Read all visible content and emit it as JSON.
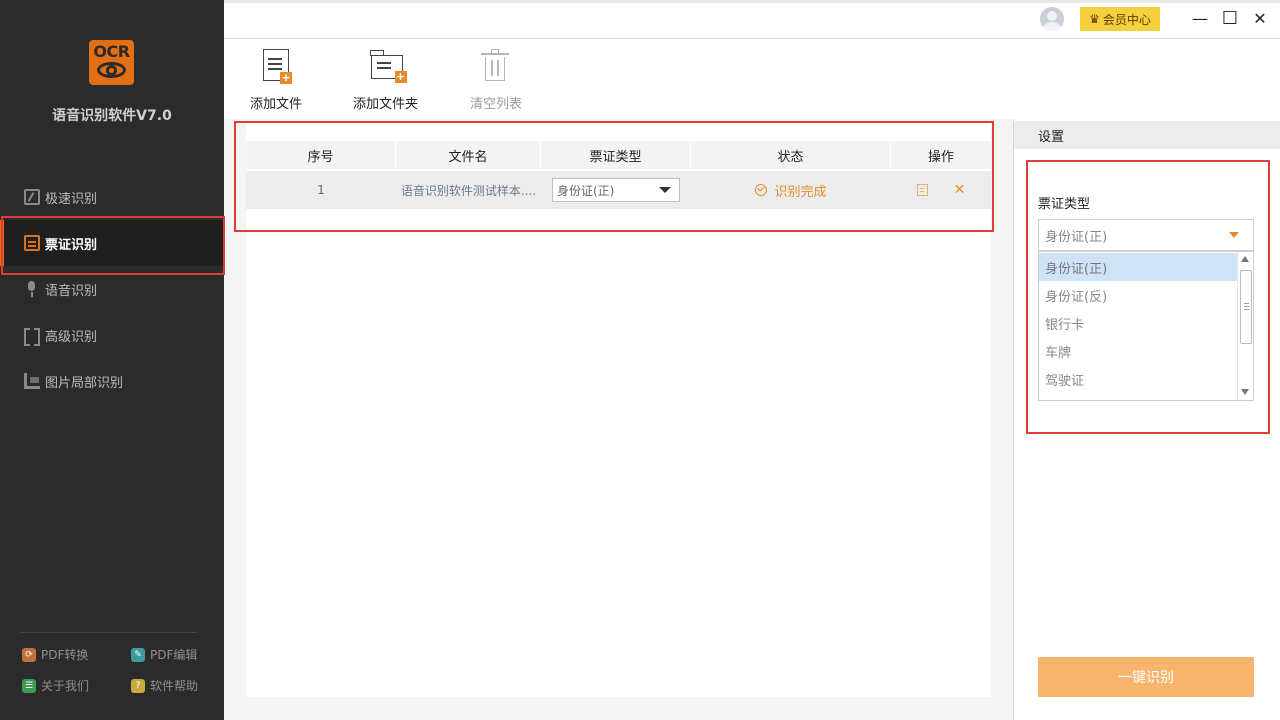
{
  "app": {
    "logo_text": "OCR",
    "title": "语音识别软件V7.0"
  },
  "sidebar": {
    "items": [
      {
        "label": "极速识别",
        "icon": "speed-icon",
        "active": false
      },
      {
        "label": "票证识别",
        "icon": "ticket-icon",
        "active": true
      },
      {
        "label": "语音识别",
        "icon": "microphone-icon",
        "active": false
      },
      {
        "label": "高级识别",
        "icon": "advanced-scan-icon",
        "active": false
      },
      {
        "label": "图片局部识别",
        "icon": "image-crop-icon",
        "active": false
      }
    ],
    "footer_links": [
      {
        "label": "PDF转换",
        "icon": "pdf-convert-icon",
        "color": "#c0703c"
      },
      {
        "label": "PDF编辑",
        "icon": "pdf-edit-icon",
        "color": "#3d9b9b"
      },
      {
        "label": "关于我们",
        "icon": "about-icon",
        "color": "#3d9b56"
      },
      {
        "label": "软件帮助",
        "icon": "help-icon",
        "color": "#c9a83c"
      }
    ]
  },
  "topbar": {
    "vip_label": "会员中心",
    "minimize": "—",
    "maximize": "☐",
    "close": "✕"
  },
  "toolbar": {
    "add_file": "添加文件",
    "add_folder": "添加文件夹",
    "clear_list": "清空列表"
  },
  "table": {
    "columns": [
      "序号",
      "文件名",
      "票证类型",
      "状态",
      "操作"
    ],
    "rows": [
      {
        "index": "1",
        "filename": "语音识别软件测试样本....",
        "type": "身份证(正)",
        "status": "识别完成"
      }
    ]
  },
  "settings": {
    "header": "设置",
    "ticket_type_label": "票证类型",
    "selected": "身份证(正)",
    "options": [
      "身份证(正)",
      "身份证(反)",
      "银行卡",
      "车牌",
      "驾驶证"
    ],
    "action_button": "一键识别"
  },
  "colors": {
    "accent": "#e88a2e",
    "highlight_border": "#e03c3c",
    "sidebar_bg": "#2b2b2b",
    "vip_bg": "#f6cf3f"
  }
}
